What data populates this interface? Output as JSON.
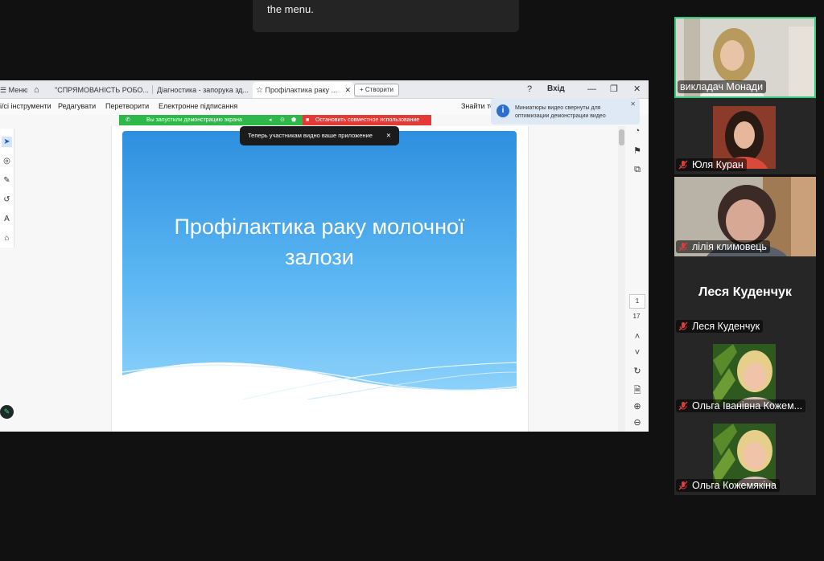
{
  "tooltip": {
    "text": "the menu."
  },
  "tabs": {
    "menu": "Меню",
    "items": [
      {
        "label": "\"СПРЯМОВАНІСТЬ РОБО..."
      },
      {
        "label": "Діагностика - запорука зд..."
      },
      {
        "label": "Профілактика раку ..."
      }
    ],
    "new_tab": "+ Створити",
    "signin": "Вхід"
  },
  "menu": {
    "items": [
      "і/сі інструменти",
      "Редагувати",
      "Перетворити",
      "Електронне підписання"
    ],
    "find": "Знайти те"
  },
  "share": {
    "started": "Вы запустили демонстрацию экрана",
    "stop": "Остановить совместное использование",
    "toast": "Теперь участникам видно ваше приложение"
  },
  "notification": {
    "text": "Миниатюры видео свернуты для оптимизации демонстрации видео"
  },
  "slide": {
    "title_line1": "Профілактика раку молочної",
    "title_line2": "залози"
  },
  "pager": {
    "current": "1",
    "total": "17"
  },
  "participants": [
    {
      "name": "викладач Монади",
      "speaking": true,
      "muted": false
    },
    {
      "name": "Юля Куран",
      "muted": true
    },
    {
      "name": "лілія климовець",
      "muted": true
    },
    {
      "name": "Леся Куденчук",
      "big_name": "Леся Куденчук",
      "muted": true
    },
    {
      "name": "Ольга Іванівна Кожем...",
      "muted": true
    },
    {
      "name": "Ольга Кожемякіна",
      "muted": true
    }
  ],
  "colors": {
    "speaking_border": "#36c87a",
    "banner_green": "#2eb849",
    "banner_red": "#e53935",
    "slide_blue": "#3aa3ea"
  }
}
